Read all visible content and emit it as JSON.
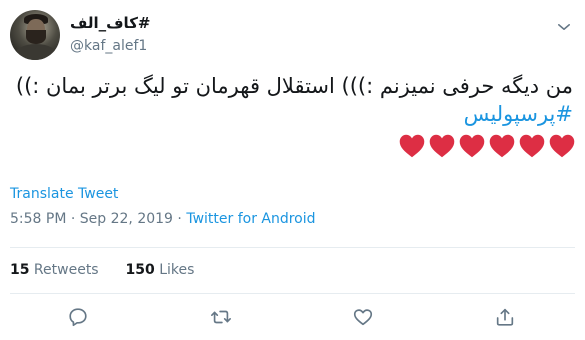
{
  "user": {
    "display_name": "#کاف_الف",
    "handle": "@kaf_alef1"
  },
  "tweet": {
    "line1": "من دیگه حرفی نمیزنم :))) استقلال قهرمان تو لیگ برتر بمان :))",
    "hashtag": "#پرسپولیس",
    "hearts_count": 6,
    "heart_color": "#dd2e44"
  },
  "translate_label": "Translate Tweet",
  "meta": {
    "time": "5:58 PM",
    "separator1": " · ",
    "date": "Sep 22, 2019",
    "separator2": " · ",
    "source": "Twitter for Android"
  },
  "stats": {
    "retweets_count": "15",
    "retweets_label": " Retweets",
    "likes_count": "150",
    "likes_label": " Likes"
  },
  "icons": {
    "caret": "chevron-down-icon",
    "reply": "reply-icon",
    "retweet": "retweet-icon",
    "like": "heart-icon",
    "share": "share-icon"
  },
  "colors": {
    "link": "#1b95e0",
    "secondary_text": "#657786",
    "divider": "#e6ecf0"
  }
}
